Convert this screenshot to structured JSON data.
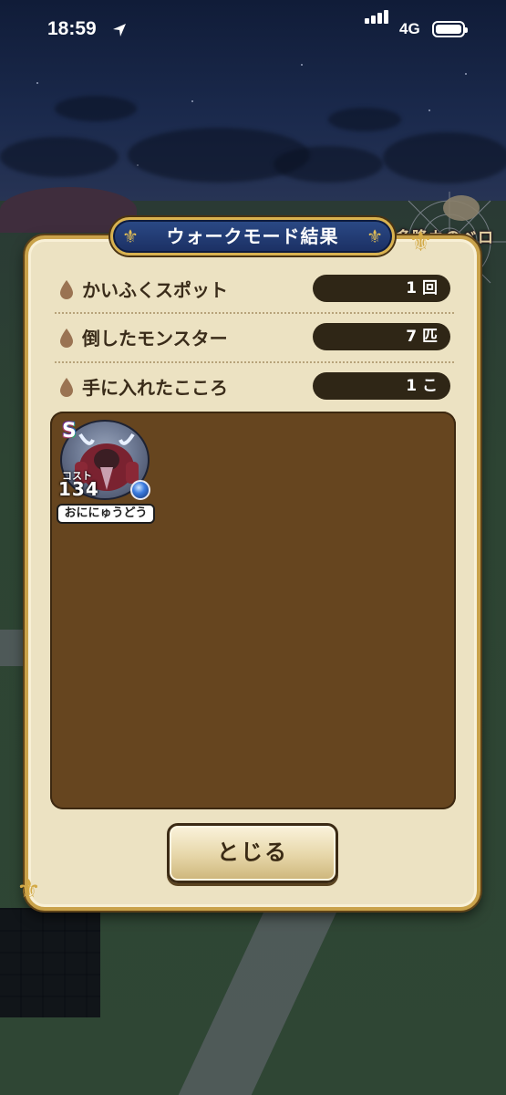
{
  "status_bar": {
    "time": "18:59",
    "network": "4G"
  },
  "dialog": {
    "title": "ウォークモード結果",
    "rows": [
      {
        "label": "かいふくスポット",
        "value": "1 回"
      },
      {
        "label": "倒したモンスター",
        "value": "7 匹"
      },
      {
        "label": "手に入れたこころ",
        "value": "1 こ"
      }
    ],
    "hearts": [
      {
        "rank": "S",
        "cost_label": "コスト",
        "cost": "134",
        "name": "おににゅうどう"
      }
    ],
    "close_label": "とじる"
  },
  "overlay": {
    "badge_text": "多隆カのベロベロ"
  },
  "colors": {
    "panel": "#ece2c2",
    "frame_gold": "#c9a24a",
    "title_blue": "#1b2f63",
    "list_brown": "#66451f",
    "pill_dark": "#2f2616"
  }
}
